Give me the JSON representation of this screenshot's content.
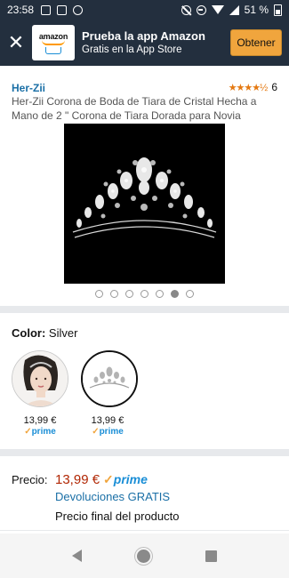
{
  "status_bar": {
    "time": "23:58",
    "battery": "51 %"
  },
  "app_banner": {
    "logo_text": "amazon",
    "title": "Prueba la app Amazon",
    "subtitle": "Gratis en la App Store",
    "cta": "Obtener"
  },
  "product": {
    "brand": "Her-Zii",
    "rating_stars": "★★★★½",
    "rating_count": "6",
    "title": "Her-Zii Corona de Boda de Tiara de Cristal Hecha a Mano de 2 \" Corona de Tiara Dorada para Novia",
    "carousel": {
      "count": 7,
      "active_index": 5
    }
  },
  "color": {
    "label": "Color:",
    "value": "Silver"
  },
  "variants": [
    {
      "name": "model",
      "price": "13,99 €",
      "prime": "prime"
    },
    {
      "name": "tiara",
      "price": "13,99 €",
      "prime": "prime"
    }
  ],
  "price": {
    "label": "Precio:",
    "value": "13,99 €",
    "prime": "prime",
    "returns": "Devoluciones GRATIS",
    "final": "Precio final del producto"
  },
  "colors": {
    "banner_bg": "#232f3e",
    "accent": "#f0a53d",
    "link": "#1a6fa6",
    "price": "#b12704",
    "prime": "#1a8ed6"
  }
}
